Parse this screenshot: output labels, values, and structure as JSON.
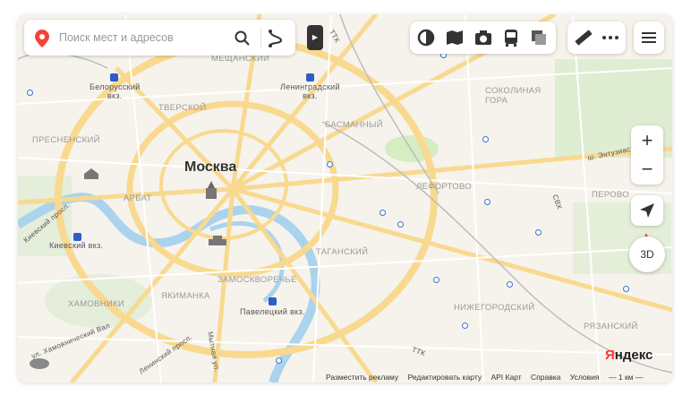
{
  "search": {
    "placeholder": "Поиск мест и адресов"
  },
  "map": {
    "city_label": "Москва",
    "district_labels": {
      "meshchansky": "МЕЩАНСКИЙ",
      "tverskoy": "ТВЕРСКОЙ",
      "presnensky": "ПРЕСНЕНСКИЙ",
      "arbat": "АРБАТ",
      "khamovniki": "ХАМОВНИКИ",
      "yakimanka": "ЯКИМАНКА",
      "zamoskvorechye": "ЗАМОСКВОРЕЧЬЕ",
      "basmanny": "БАСМАННЫЙ",
      "lefortovo": "ЛЕФОРТОВО",
      "tagansky": "ТАГАНСКИЙ",
      "nizhegorodsky": "НИЖЕГОРОДСКИЙ",
      "sokolnicheskaya_gora": "СОКОЛИНАЯ\nГОРА",
      "perovo": "ПЕРОВО",
      "ryazansky": "РЯЗАНСКИЙ"
    },
    "station_labels": {
      "belorussky": "Белорусский\nвкз.",
      "leningradsky": "Ленинградский\nвкз.",
      "kievsky": "Киевский вкз.",
      "paveletsky": "Павелецкий вкз."
    },
    "road_labels": {
      "ttk_top": "ТТК",
      "ttk_bottom": "ТТК",
      "entuziastov": "ш. Энтузиаста",
      "svkh": "СВХ",
      "khamovnichesky_val": "ул. Хамовнический Вал",
      "leninsky": "Ленинский просп.",
      "mytnaya": "Мытная ул.",
      "kievsky_prosp": "Киевский просп."
    }
  },
  "controls": {
    "zoom_in": "+",
    "zoom_out": "−",
    "threed_label": "3D"
  },
  "footer": {
    "links": [
      "Разместить рекламу",
      "Редактировать карту",
      "API Карт",
      "Справка",
      "Условия"
    ],
    "logo_y": "Я",
    "logo_rest": "ндекс",
    "scale_label": "1 км"
  },
  "colors": {
    "background": "#f6f3ec",
    "major_road": "#f8d98f",
    "park": "#d6ecc2",
    "water": "#aad3ee",
    "metro": "#3a72d4",
    "accent": "#e53935"
  },
  "icons": [
    "map-pin-icon",
    "search-icon",
    "route-icon",
    "play-icon",
    "traffic-icon",
    "panorama-icon",
    "camera-icon",
    "transport-icon",
    "layers-icon",
    "ruler-icon",
    "more-icon",
    "menu-icon",
    "geolocation-icon"
  ]
}
